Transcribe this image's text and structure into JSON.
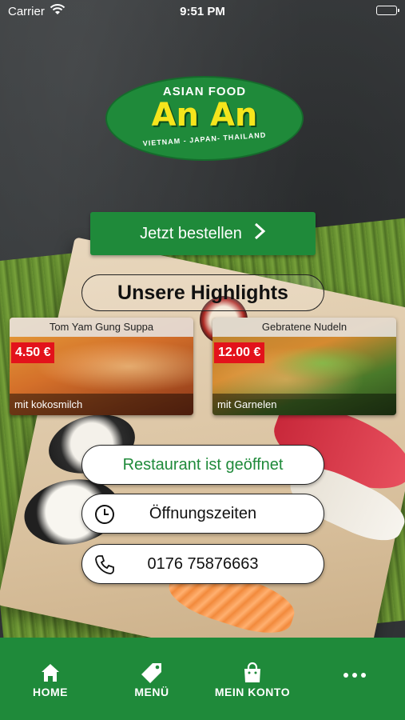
{
  "status_bar": {
    "carrier": "Carrier",
    "time": "9:51 PM",
    "battery_level": 1.0
  },
  "logo": {
    "top_text": "ASIAN FOOD",
    "main_text": "An An",
    "bottom_text": "VIETNAM - JAPAN- THAILAND",
    "colors": {
      "background": "#1f8a3a",
      "main_text": "#f5e51c"
    }
  },
  "order_button": {
    "label": "Jetzt bestellen",
    "icon": "chevron-right-icon"
  },
  "highlights": {
    "title": "Unsere Highlights",
    "items": [
      {
        "title": "Tom Yam Gung Suppa",
        "price": "4.50 €",
        "subtitle": "mit kokosmilch"
      },
      {
        "title": "Gebratene Nudeln",
        "price": "12.00 €",
        "subtitle": "mit Garnelen"
      }
    ]
  },
  "info_buttons": {
    "status": "Restaurant ist geöffnet",
    "hours": {
      "label": "Öffnungszeiten",
      "icon": "clock-icon"
    },
    "phone": {
      "label": "0176 75876663",
      "icon": "phone-icon"
    }
  },
  "tab_bar": {
    "tabs": [
      {
        "label": "HOME",
        "icon": "home-icon"
      },
      {
        "label": "MENÜ",
        "icon": "tag-icon"
      },
      {
        "label": "MEIN KONTO",
        "icon": "shopping-bag-icon"
      },
      {
        "label": "",
        "icon": "more-dots-icon"
      }
    ]
  },
  "colors": {
    "brand_green": "#1f8a3a",
    "price_red": "#e3121b",
    "status_open_text": "#1f8a3a"
  }
}
